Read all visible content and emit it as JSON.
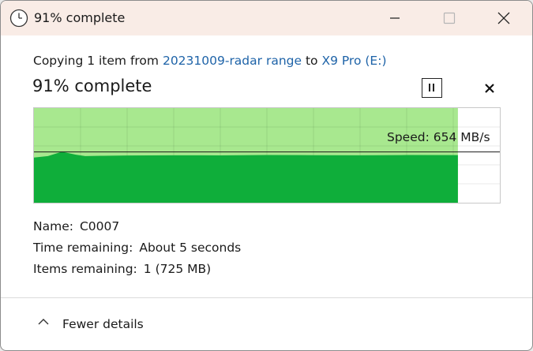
{
  "window": {
    "title": "91% complete",
    "title_icon": "clock-icon",
    "minimize_icon": "minimize-icon",
    "maximize_icon": "maximize-icon",
    "close_icon": "close-icon"
  },
  "copy": {
    "prefix": "Copying 1 item from ",
    "source": "20231009-radar range",
    "middle": " to ",
    "destination": "X9 Pro (E:)",
    "link_color": "#1e63a8"
  },
  "progress": {
    "heading": "91% complete",
    "percent": 91,
    "pause_icon": "pause-icon",
    "cancel_icon": "cancel-x-icon",
    "fill_color": "#0fae3a",
    "background_color": "#a8e88f"
  },
  "speed": {
    "label": "Speed: 654 MB/s"
  },
  "chart_data": {
    "type": "area",
    "x": [
      0,
      3,
      6,
      9,
      11,
      15,
      20,
      30,
      40,
      50,
      60,
      70,
      80,
      91
    ],
    "values": [
      620,
      640,
      700,
      660,
      640,
      645,
      648,
      652,
      650,
      655,
      653,
      652,
      655,
      654
    ],
    "ylim": [
      0,
      1300
    ],
    "xlim": [
      0,
      100
    ],
    "current": 654,
    "grid": true
  },
  "details": {
    "name_label": "Name:",
    "name_value": "C0007",
    "time_label": "Time remaining:",
    "time_value": "About 5 seconds",
    "items_label": "Items remaining:",
    "items_value": "1 (725 MB)"
  },
  "footer": {
    "toggle_label": "Fewer details",
    "toggle_icon": "chevron-up-icon"
  }
}
